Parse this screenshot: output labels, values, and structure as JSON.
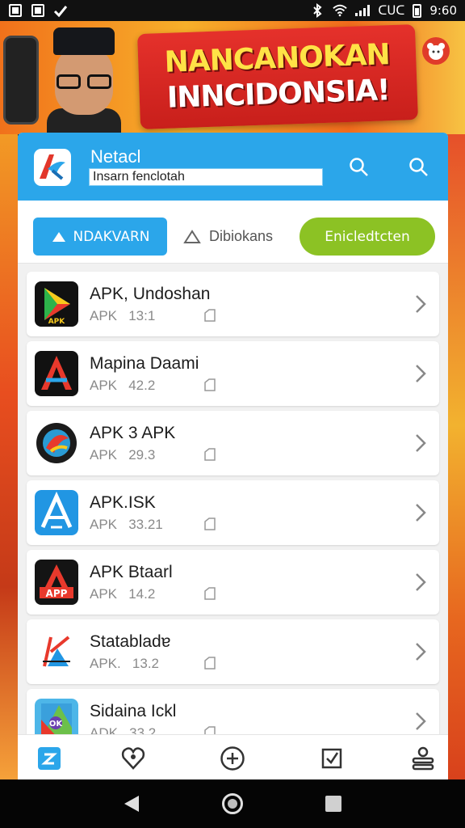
{
  "status_bar": {
    "network_label": "ᑕᑌᑕ",
    "time": "9:60"
  },
  "banner": {
    "line1": "NANCANOKAN",
    "line2": "INNCIDONSIA!",
    "colors": {
      "banner_red": "#e5312b",
      "headline_yellow": "#ffe246",
      "background_orange": "#f1711b"
    }
  },
  "header": {
    "app_name": "Netacl",
    "search_value": "Insarn fenclotah",
    "accent_color": "#2ba6ea",
    "icons": [
      "app-logo",
      "search-icon",
      "search-icon"
    ]
  },
  "filters": {
    "primary_label": "NDAKVARN",
    "secondary_label": "Dibiokans",
    "green_label": "Enicledtcten",
    "green_color": "#8cc224"
  },
  "apps": [
    {
      "title": "APK, Undoshan",
      "kind": "APK",
      "size": "13:1",
      "icon": "apk-play-icon"
    },
    {
      "title": "Mapina Daami",
      "kind": "APK",
      "size": "42.2",
      "icon": "apk-a-red-icon"
    },
    {
      "title": "APK 3 APK",
      "kind": "APK",
      "size": "29.3",
      "icon": "apk-round-icon"
    },
    {
      "title": "APK.ISK",
      "kind": "APK",
      "size": "33.21",
      "icon": "apk-a-blue-icon"
    },
    {
      "title": "APK Btaarl",
      "kind": "APK",
      "size": "14.2",
      "icon": "apk-a-red-dark-icon"
    },
    {
      "title": "Statabladɐ",
      "kind": "APK.",
      "size": "13.2",
      "icon": "apk-k-icon"
    },
    {
      "title": "Sidaina Ickl",
      "kind": "ADK",
      "size": "33.2",
      "icon": "apk-ok-icon"
    }
  ],
  "tabs": [
    "home-icon",
    "favorites-icon",
    "add-icon",
    "tasks-icon",
    "storage-icon"
  ]
}
